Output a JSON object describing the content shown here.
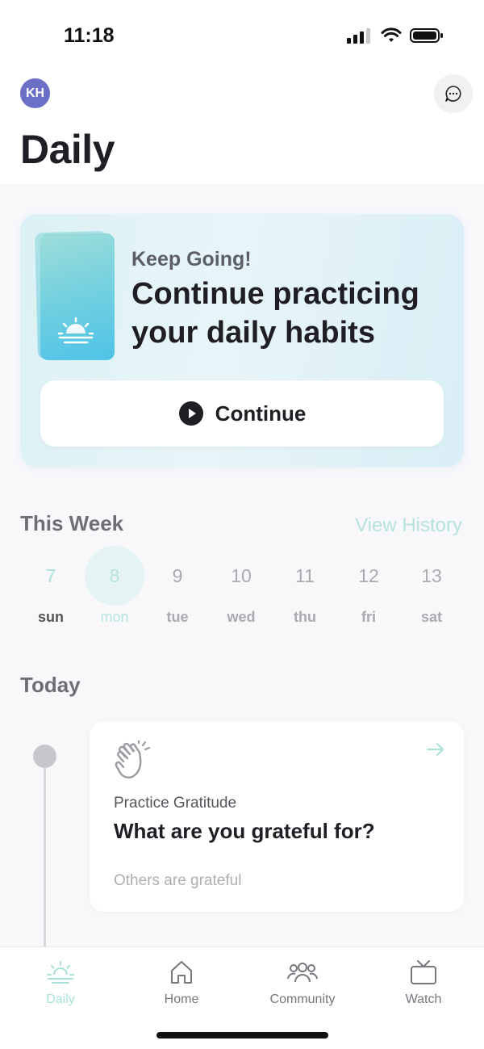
{
  "status_bar": {
    "time": "11:18"
  },
  "header": {
    "avatar_initials": "KH",
    "title": "Daily"
  },
  "hero": {
    "subtitle": "Keep Going!",
    "title": "Continue practicing your daily habits",
    "button_label": "Continue"
  },
  "week": {
    "title": "This Week",
    "view_history": "View History",
    "days": [
      {
        "num": "7",
        "name": "sun"
      },
      {
        "num": "8",
        "name": "mon"
      },
      {
        "num": "9",
        "name": "tue"
      },
      {
        "num": "10",
        "name": "wed"
      },
      {
        "num": "11",
        "name": "thu"
      },
      {
        "num": "12",
        "name": "fri"
      },
      {
        "num": "13",
        "name": "sat"
      }
    ]
  },
  "today": {
    "title": "Today",
    "task": {
      "category": "Practice Gratitude",
      "title": "What are you grateful for?",
      "meta": "Others are grateful"
    }
  },
  "tabs": [
    {
      "label": "Daily"
    },
    {
      "label": "Home"
    },
    {
      "label": "Community"
    },
    {
      "label": "Watch"
    }
  ]
}
